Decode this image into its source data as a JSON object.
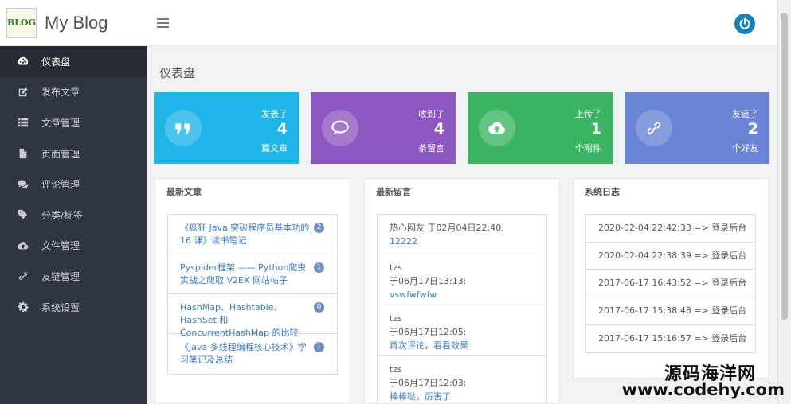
{
  "brand": {
    "name": "My Blog",
    "logo_line1": "BLOG",
    "logo_line2": ""
  },
  "sidebar": {
    "items": [
      {
        "label": "仪表盘",
        "icon": "dashboard-icon"
      },
      {
        "label": "发布文章",
        "icon": "edit-icon"
      },
      {
        "label": "文章管理",
        "icon": "list-icon"
      },
      {
        "label": "页面管理",
        "icon": "file-icon"
      },
      {
        "label": "评论管理",
        "icon": "comments-icon"
      },
      {
        "label": "分类/标签",
        "icon": "tags-icon"
      },
      {
        "label": "文件管理",
        "icon": "cloud-upload-icon"
      },
      {
        "label": "友链管理",
        "icon": "link-icon"
      },
      {
        "label": "系统设置",
        "icon": "gear-icon"
      }
    ]
  },
  "header": {
    "page_title": "仪表盘"
  },
  "stats": [
    {
      "title": "发表了",
      "value": "4",
      "unit": "篇文章",
      "color": "#1fb5e8",
      "icon": "quote-icon"
    },
    {
      "title": "收到了",
      "value": "4",
      "unit": "条留言",
      "color": "#8e58c2",
      "icon": "comments-icon"
    },
    {
      "title": "上传了",
      "value": "1",
      "unit": "个附件",
      "color": "#3cb563",
      "icon": "cloud-upload-icon"
    },
    {
      "title": "友链了",
      "value": "2",
      "unit": "个好友",
      "color": "#6a84d6",
      "icon": "link-icon"
    }
  ],
  "articles": {
    "title": "最新文章",
    "items": [
      {
        "text": "《疯狂 Java 突破程序员基本功的 16 课》读书笔记",
        "count": "2"
      },
      {
        "text": "Pyspider框架 —— Python爬虫实战之爬取 V2EX 网站帖子",
        "count": "1"
      },
      {
        "text": "HashMap、Hashtable、HashSet 和 ConcurrentHashMap 的比较",
        "count": "0"
      },
      {
        "text": "《Java 多线程编程核心技术》学习笔记及总结",
        "count": "1"
      }
    ]
  },
  "comments": {
    "title": "最新留言",
    "items": [
      {
        "who": "热心网友 于02月04日22:40:",
        "when": "",
        "text": "12222"
      },
      {
        "who": "tzs",
        "when": "于06月17日13:13:",
        "text": "vswfwfwfw"
      },
      {
        "who": "tzs",
        "when": "于06月17日12:05:",
        "text": "再次评论，看看效果"
      },
      {
        "who": "tzs",
        "when": "于06月17日12:03:",
        "text": "棒棒哒，厉害了"
      }
    ]
  },
  "logs": {
    "title": "系统日志",
    "items": [
      "2020-02-04 22:42:33 => 登录后台",
      "2020-02-04 22:38:39 => 登录后台",
      "2017-06-17 16:43:52 => 登录后台",
      "2017-06-17 15:38:48 => 登录后台",
      "2017-06-17 15:16:57 => 登录后台"
    ]
  },
  "watermark": {
    "line1": "源码海洋网",
    "line2": "www.codehy.com"
  },
  "colors": {
    "sidebar": "#303641",
    "accent": "#1a7fb5"
  }
}
